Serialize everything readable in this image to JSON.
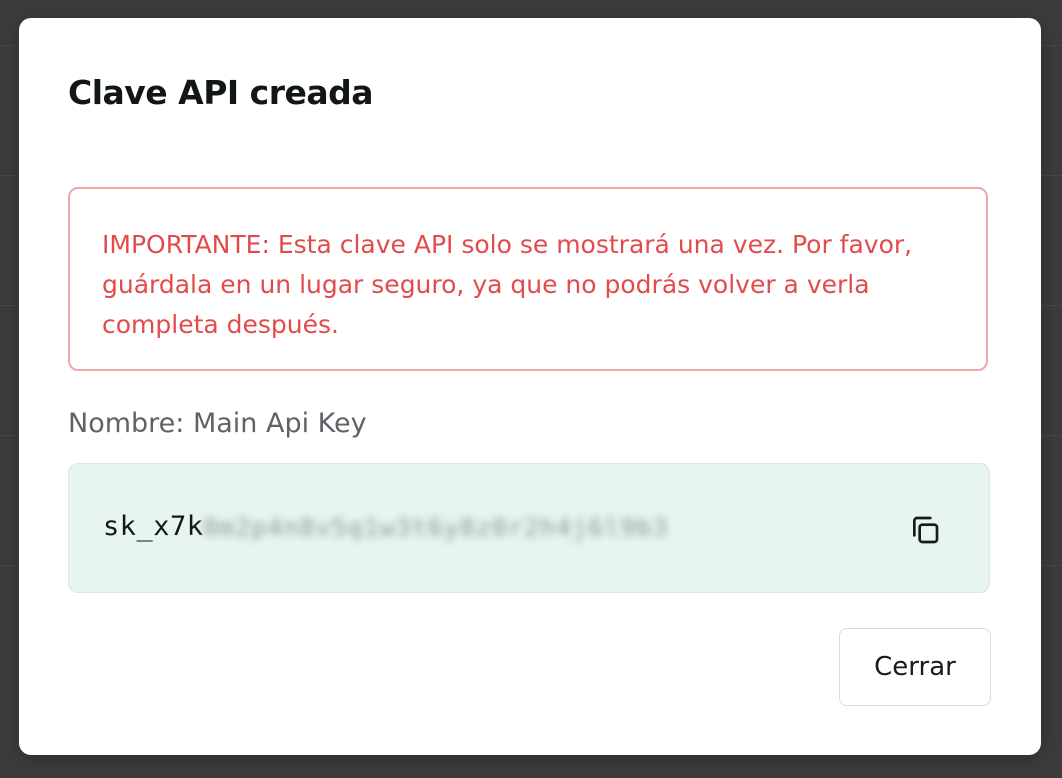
{
  "modal": {
    "title": "Clave API creada",
    "warning": "IMPORTANTE: Esta clave API solo se mostrará una vez. Por favor, guárdala en un lugar seguro, ya que no podrás volver a verla completa después.",
    "key_name": "Nombre: Main Api Key",
    "key_prefix": "sk_x7k",
    "key_masked": "0m2p4n8v5q1w3t6y8z0r2h4j6l9b3",
    "copy_icon": "copy-icon",
    "close_label": "Cerrar"
  },
  "colors": {
    "warning_text": "#e24b4b",
    "warning_border": "#f2a5a5",
    "key_background": "#e7f5f2"
  }
}
